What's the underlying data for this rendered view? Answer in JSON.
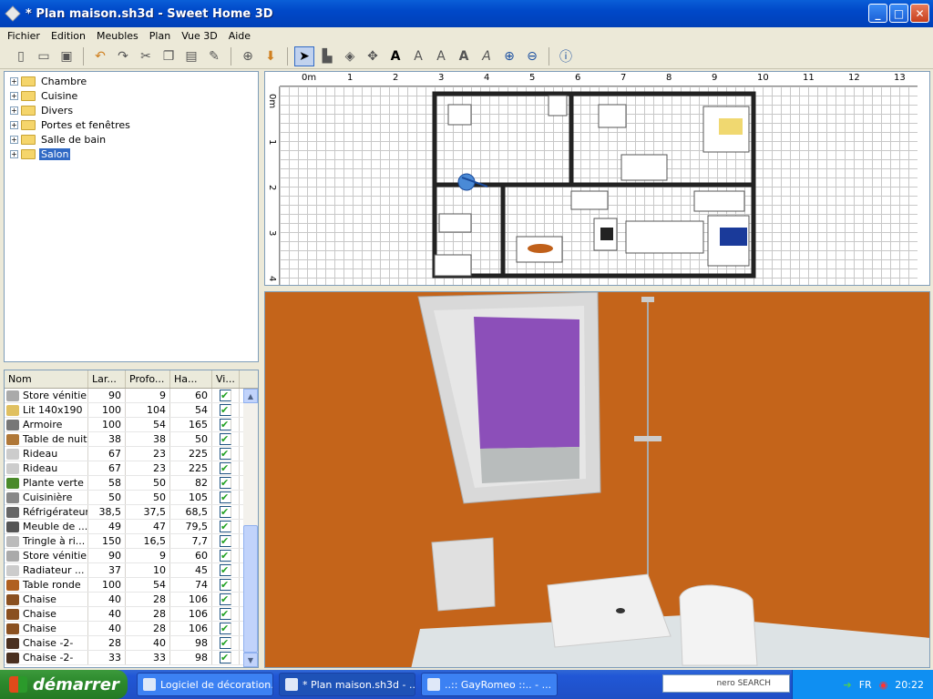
{
  "window": {
    "title": "* Plan maison.sh3d - Sweet Home 3D"
  },
  "menu": [
    "Fichier",
    "Edition",
    "Meubles",
    "Plan",
    "Vue 3D",
    "Aide"
  ],
  "tree": [
    {
      "label": "Chambre",
      "selected": false
    },
    {
      "label": "Cuisine",
      "selected": false
    },
    {
      "label": "Divers",
      "selected": false
    },
    {
      "label": "Portes et fenêtres",
      "selected": false
    },
    {
      "label": "Salle de bain",
      "selected": false
    },
    {
      "label": "Salon",
      "selected": true
    }
  ],
  "table": {
    "headers": [
      "Nom",
      "Lar...",
      "Profo...",
      "Ha...",
      "Vi..."
    ],
    "rows": [
      {
        "name": "Store vénitien",
        "w": "90",
        "d": "9",
        "h": "60",
        "color": "#aaaaaa"
      },
      {
        "name": "Lit 140x190",
        "w": "100",
        "d": "104",
        "h": "54",
        "color": "#e0c060"
      },
      {
        "name": "Armoire",
        "w": "100",
        "d": "54",
        "h": "165",
        "color": "#777777"
      },
      {
        "name": "Table de nuit",
        "w": "38",
        "d": "38",
        "h": "50",
        "color": "#b07838"
      },
      {
        "name": "Rideau",
        "w": "67",
        "d": "23",
        "h": "225",
        "color": "#cccccc"
      },
      {
        "name": "Rideau",
        "w": "67",
        "d": "23",
        "h": "225",
        "color": "#cccccc"
      },
      {
        "name": "Plante verte",
        "w": "58",
        "d": "50",
        "h": "82",
        "color": "#4a8a2a"
      },
      {
        "name": "Cuisinière",
        "w": "50",
        "d": "50",
        "h": "105",
        "color": "#888888"
      },
      {
        "name": "Réfrigérateur",
        "w": "38,5",
        "d": "37,5",
        "h": "68,5",
        "color": "#666666"
      },
      {
        "name": "Meuble de ...",
        "w": "49",
        "d": "47",
        "h": "79,5",
        "color": "#555555"
      },
      {
        "name": "Tringle à ri...",
        "w": "150",
        "d": "16,5",
        "h": "7,7",
        "color": "#bbbbbb"
      },
      {
        "name": "Store vénitien",
        "w": "90",
        "d": "9",
        "h": "60",
        "color": "#aaaaaa"
      },
      {
        "name": "Radiateur ...",
        "w": "37",
        "d": "10",
        "h": "45",
        "color": "#cccccc"
      },
      {
        "name": "Table ronde",
        "w": "100",
        "d": "54",
        "h": "74",
        "color": "#b06020"
      },
      {
        "name": "Chaise",
        "w": "40",
        "d": "28",
        "h": "106",
        "color": "#8a5020"
      },
      {
        "name": "Chaise",
        "w": "40",
        "d": "28",
        "h": "106",
        "color": "#8a5020"
      },
      {
        "name": "Chaise",
        "w": "40",
        "d": "28",
        "h": "106",
        "color": "#8a5020"
      },
      {
        "name": "Chaise -2-",
        "w": "28",
        "d": "40",
        "h": "98",
        "color": "#4a3020"
      },
      {
        "name": "Chaise -2-",
        "w": "33",
        "d": "33",
        "h": "98",
        "color": "#4a3020"
      }
    ]
  },
  "ruler": {
    "h": [
      "0m",
      "1",
      "2",
      "3",
      "4",
      "5",
      "6",
      "7",
      "8",
      "9",
      "10",
      "11",
      "12",
      "13"
    ],
    "v": [
      "0m",
      "1",
      "2",
      "3",
      "4"
    ]
  },
  "taskbar": {
    "start": "démarrer",
    "tasks": [
      "Logiciel de décoration...",
      "* Plan maison.sh3d - ...",
      "..:: GayRomeo ::.. - ..."
    ],
    "lang": "FR",
    "clock": "20:22",
    "search_brand": "nero SEARCH"
  }
}
